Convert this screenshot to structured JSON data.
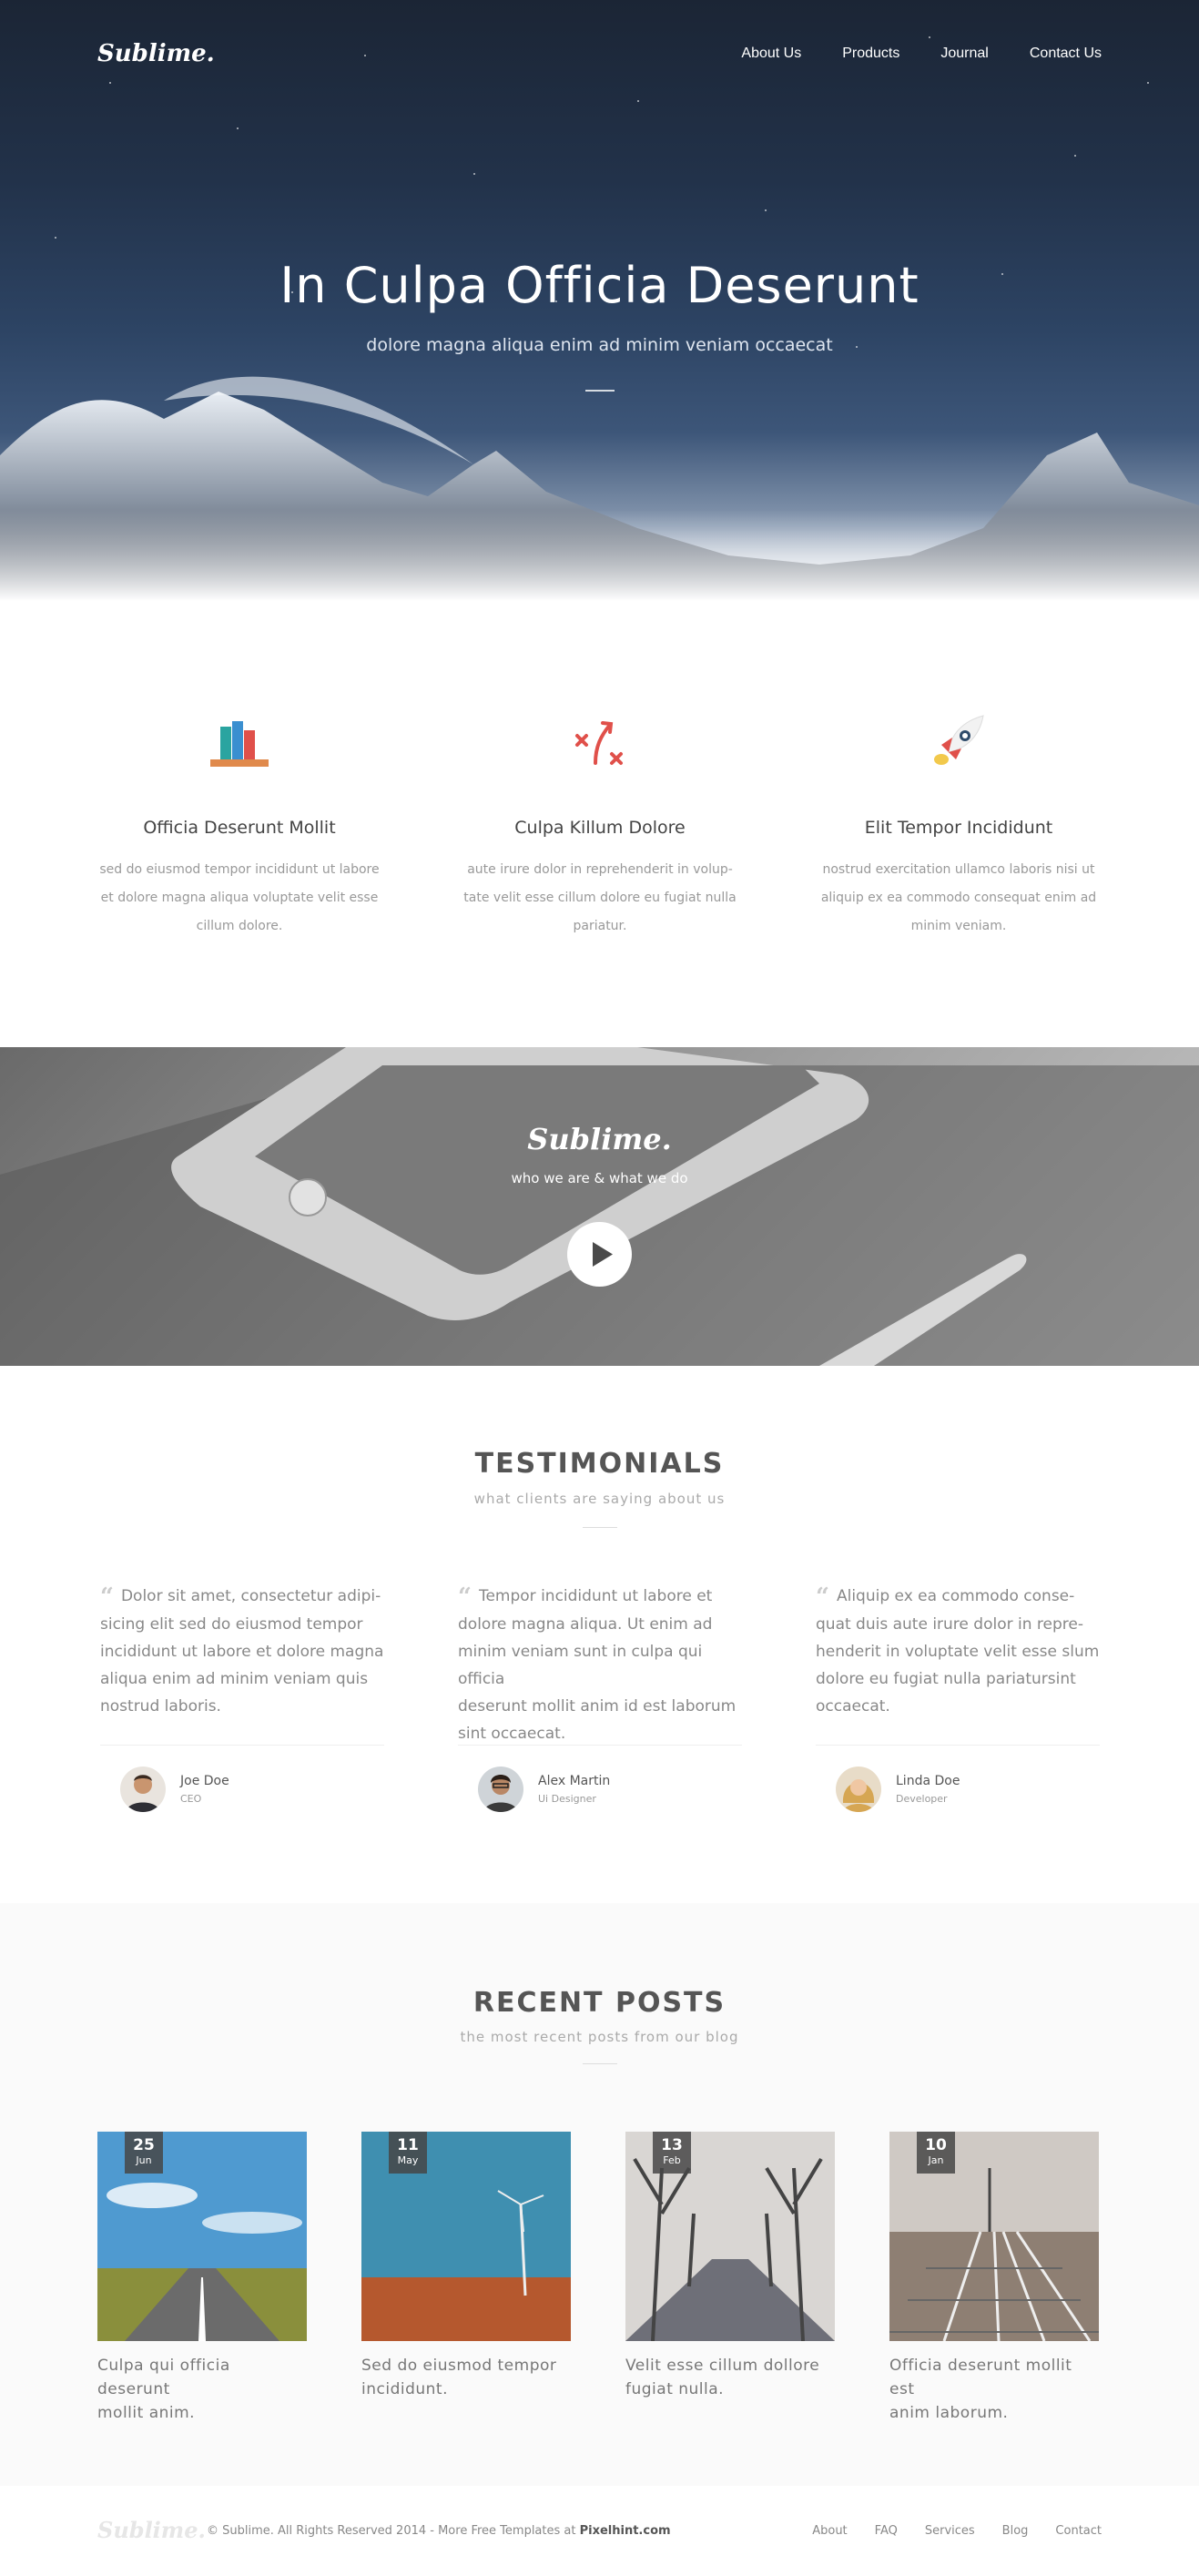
{
  "header": {
    "logo": "Sublime.",
    "nav": [
      "About Us",
      "Products",
      "Journal",
      "Contact Us"
    ]
  },
  "hero": {
    "title": "In Culpa Officia Deserunt",
    "subtitle": "dolore magna aliqua enim ad minim veniam occaecat"
  },
  "features": [
    {
      "icon": "books-icon",
      "title": "Officia Deserunt Mollit",
      "text_lines": [
        "sed do eiusmod tempor incididunt ut labore",
        "et dolore magna aliqua voluptate velit esse",
        "cillum dolore."
      ]
    },
    {
      "icon": "strategy-icon",
      "title": "Culpa Killum Dolore",
      "text_lines": [
        "aute irure dolor in reprehenderit in volup-",
        "tate velit esse cillum dolore eu fugiat nulla",
        "pariatur."
      ]
    },
    {
      "icon": "rocket-icon",
      "title": "Elit Tempor Incididunt",
      "text_lines": [
        "nostrud exercitation ullamco laboris nisi ut",
        "aliquip ex ea commodo consequat enim ad",
        "minim veniam."
      ]
    }
  ],
  "video": {
    "logo": "Sublime.",
    "tagline": "who we are & what we do",
    "play_icon": "play-icon"
  },
  "testimonials": {
    "title": "TESTIMONIALS",
    "subtitle": "what clients are saying about us",
    "items": [
      {
        "lines": [
          "Dolor sit amet, consectetur adipi-",
          "sicing elit sed do eiusmod tempor",
          "incididunt ut labore et dolore magna",
          "aliqua enim ad minim veniam quis",
          "nostrud laboris."
        ],
        "name": "Joe Doe",
        "role": "CEO"
      },
      {
        "lines": [
          "Tempor incididunt ut labore et",
          "dolore magna aliqua. Ut enim ad",
          "minim veniam sunt in culpa qui officia",
          "deserunt mollit anim id est laborum",
          "sint occaecat."
        ],
        "name": "Alex Martin",
        "role": "Ui Designer"
      },
      {
        "lines": [
          "Aliquip ex ea commodo conse-",
          "quat duis aute irure dolor in repre-",
          "henderit in voluptate velit esse slum",
          "dolore eu fugiat nulla pariatursint",
          "occaecat."
        ],
        "name": "Linda Doe",
        "role": "Developer"
      }
    ]
  },
  "posts": {
    "title": "RECENT POSTS",
    "subtitle": "the most recent posts from our blog",
    "items": [
      {
        "day": "25",
        "month": "Jun",
        "title_lines": [
          "Culpa qui officia deserunt",
          "mollit anim."
        ]
      },
      {
        "day": "11",
        "month": "May",
        "title_lines": [
          "Sed do eiusmod tempor",
          "incididunt."
        ]
      },
      {
        "day": "13",
        "month": "Feb",
        "title_lines": [
          "Velit esse cillum dollore",
          "fugiat nulla."
        ]
      },
      {
        "day": "10",
        "month": "Jan",
        "title_lines": [
          "Officia deserunt mollit est",
          "anim laborum."
        ]
      }
    ]
  },
  "footer": {
    "logo": "Sublime.",
    "copyright": "© Sublime. All Rights Reserved 2014 - More Free Templates at",
    "credit": "Pixelhint.com",
    "nav": [
      "About",
      "FAQ",
      "Services",
      "Blog",
      "Contact"
    ]
  }
}
